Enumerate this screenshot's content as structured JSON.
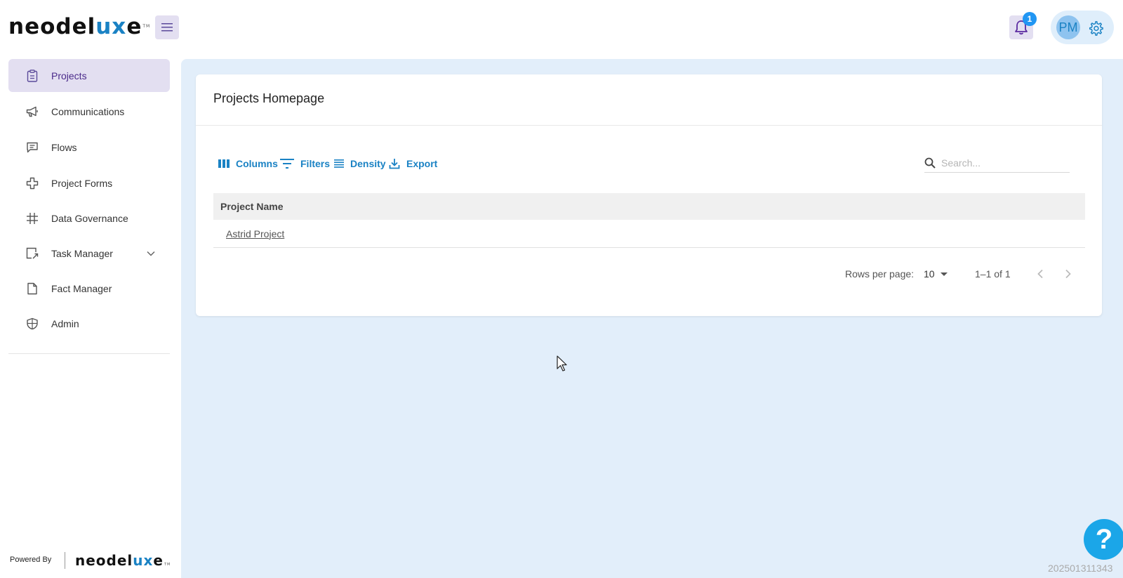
{
  "brand": {
    "pre": "neodel",
    "ux": "ux",
    "post": "e",
    "tm": "TM"
  },
  "header": {
    "notification_count": "1",
    "avatar_initials": "PM"
  },
  "sidebar": {
    "items": [
      {
        "label": "Projects"
      },
      {
        "label": "Communications"
      },
      {
        "label": "Flows"
      },
      {
        "label": "Project Forms"
      },
      {
        "label": "Data Governance"
      },
      {
        "label": "Task Manager"
      },
      {
        "label": "Fact Manager"
      },
      {
        "label": "Admin"
      }
    ],
    "powered_by": "Powered By"
  },
  "main": {
    "title": "Projects Homepage",
    "toolbar": {
      "columns": "Columns",
      "filters": "Filters",
      "density": "Density",
      "export": "Export"
    },
    "search": {
      "placeholder": "Search..."
    },
    "table": {
      "columns": [
        "Project Name"
      ],
      "rows": [
        {
          "project_name": "Astrid Project"
        }
      ]
    },
    "pagination": {
      "rows_per_page_label": "Rows per page:",
      "rows_per_page": "10",
      "range": "1–1 of 1"
    }
  },
  "build_id": "202501311343",
  "colors": {
    "accent": "#1a82c4",
    "active_nav": "#e3dff1",
    "main_bg": "#e2eefa",
    "help": "#1ba6e8"
  }
}
